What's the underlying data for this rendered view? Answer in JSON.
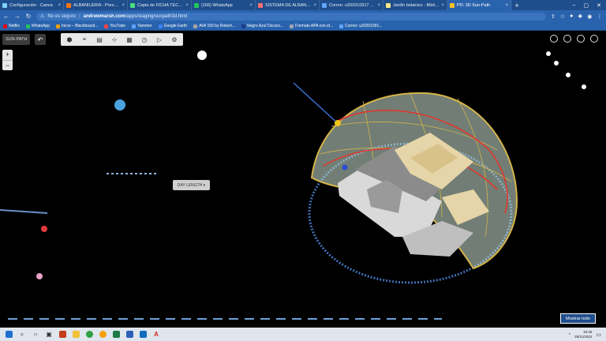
{
  "browser": {
    "tabs": [
      {
        "title": "Configuración - Canva",
        "color": "#7dd3fc",
        "active": false
      },
      {
        "title": "ALBAÑILERIA - Presentación",
        "color": "#f97316",
        "active": false
      },
      {
        "title": "Copia de FICHA TÉCNICA",
        "color": "#4ade80",
        "active": false
      },
      {
        "title": "(166) WhatsApp",
        "color": "#22c55e",
        "active": false
      },
      {
        "title": "SISTEMA DE ALBAÑILERÍA",
        "color": "#f87171",
        "active": false
      },
      {
        "title": "Correo: u202010917 (Alex",
        "color": "#60a5fa",
        "active": false
      },
      {
        "title": "Jardín botanico - Biblioteca",
        "color": "#fde68a",
        "active": false
      },
      {
        "title": "PD: 3D Sun-Path",
        "color": "#fbbf24",
        "active": true
      }
    ],
    "close_glyph": "×",
    "new_tab": "+",
    "security": "No es seguro",
    "url_host": "andrewmarsh.com",
    "url_path": "/apps/staging/sunpath3d.html",
    "bookmarks": [
      {
        "label": "Netflix",
        "color": "#e50914"
      },
      {
        "label": "WhatsApp",
        "color": "#22c55e"
      },
      {
        "label": "Inicio – Blackboard...",
        "color": "#f59e0b"
      },
      {
        "label": "YouTube",
        "color": "#ef4444"
      },
      {
        "label": "Yammer",
        "color": "#60a5fa"
      },
      {
        "label": "Google Earth",
        "color": "#3b82f6"
      },
      {
        "label": "AVA 159 by Robert...",
        "color": "#a3a3a3"
      },
      {
        "label": "Negro Azul Oscuro...",
        "color": "#1e3a8a"
      },
      {
        "label": "Formato APA con el...",
        "color": "#9ca3af"
      },
      {
        "label": "Correo: u20201091...",
        "color": "#60a5fa"
      }
    ]
  },
  "app": {
    "sunpath_label": "SUN-PATH",
    "undo": "↶",
    "toolbar_icons": [
      "cube-icon",
      "location-icon",
      "ruler-icon",
      "grid-icon",
      "table-icon",
      "clock-icon",
      "play-icon",
      "gear-icon"
    ],
    "zoom_in": "+",
    "zoom_out": "−",
    "day_length_label": "DAY LENGTH ▾",
    "mostrar_label": "Mostrar todo"
  },
  "colors": {
    "dome_fill": "#cfe6d6",
    "dome_edge": "#d4b44a",
    "sun_path": "#e0362c",
    "building": "#e6d5a8",
    "ground": "#d9d9d9"
  },
  "taskbar": {
    "time": "19:45",
    "date": "28/11/2022"
  }
}
